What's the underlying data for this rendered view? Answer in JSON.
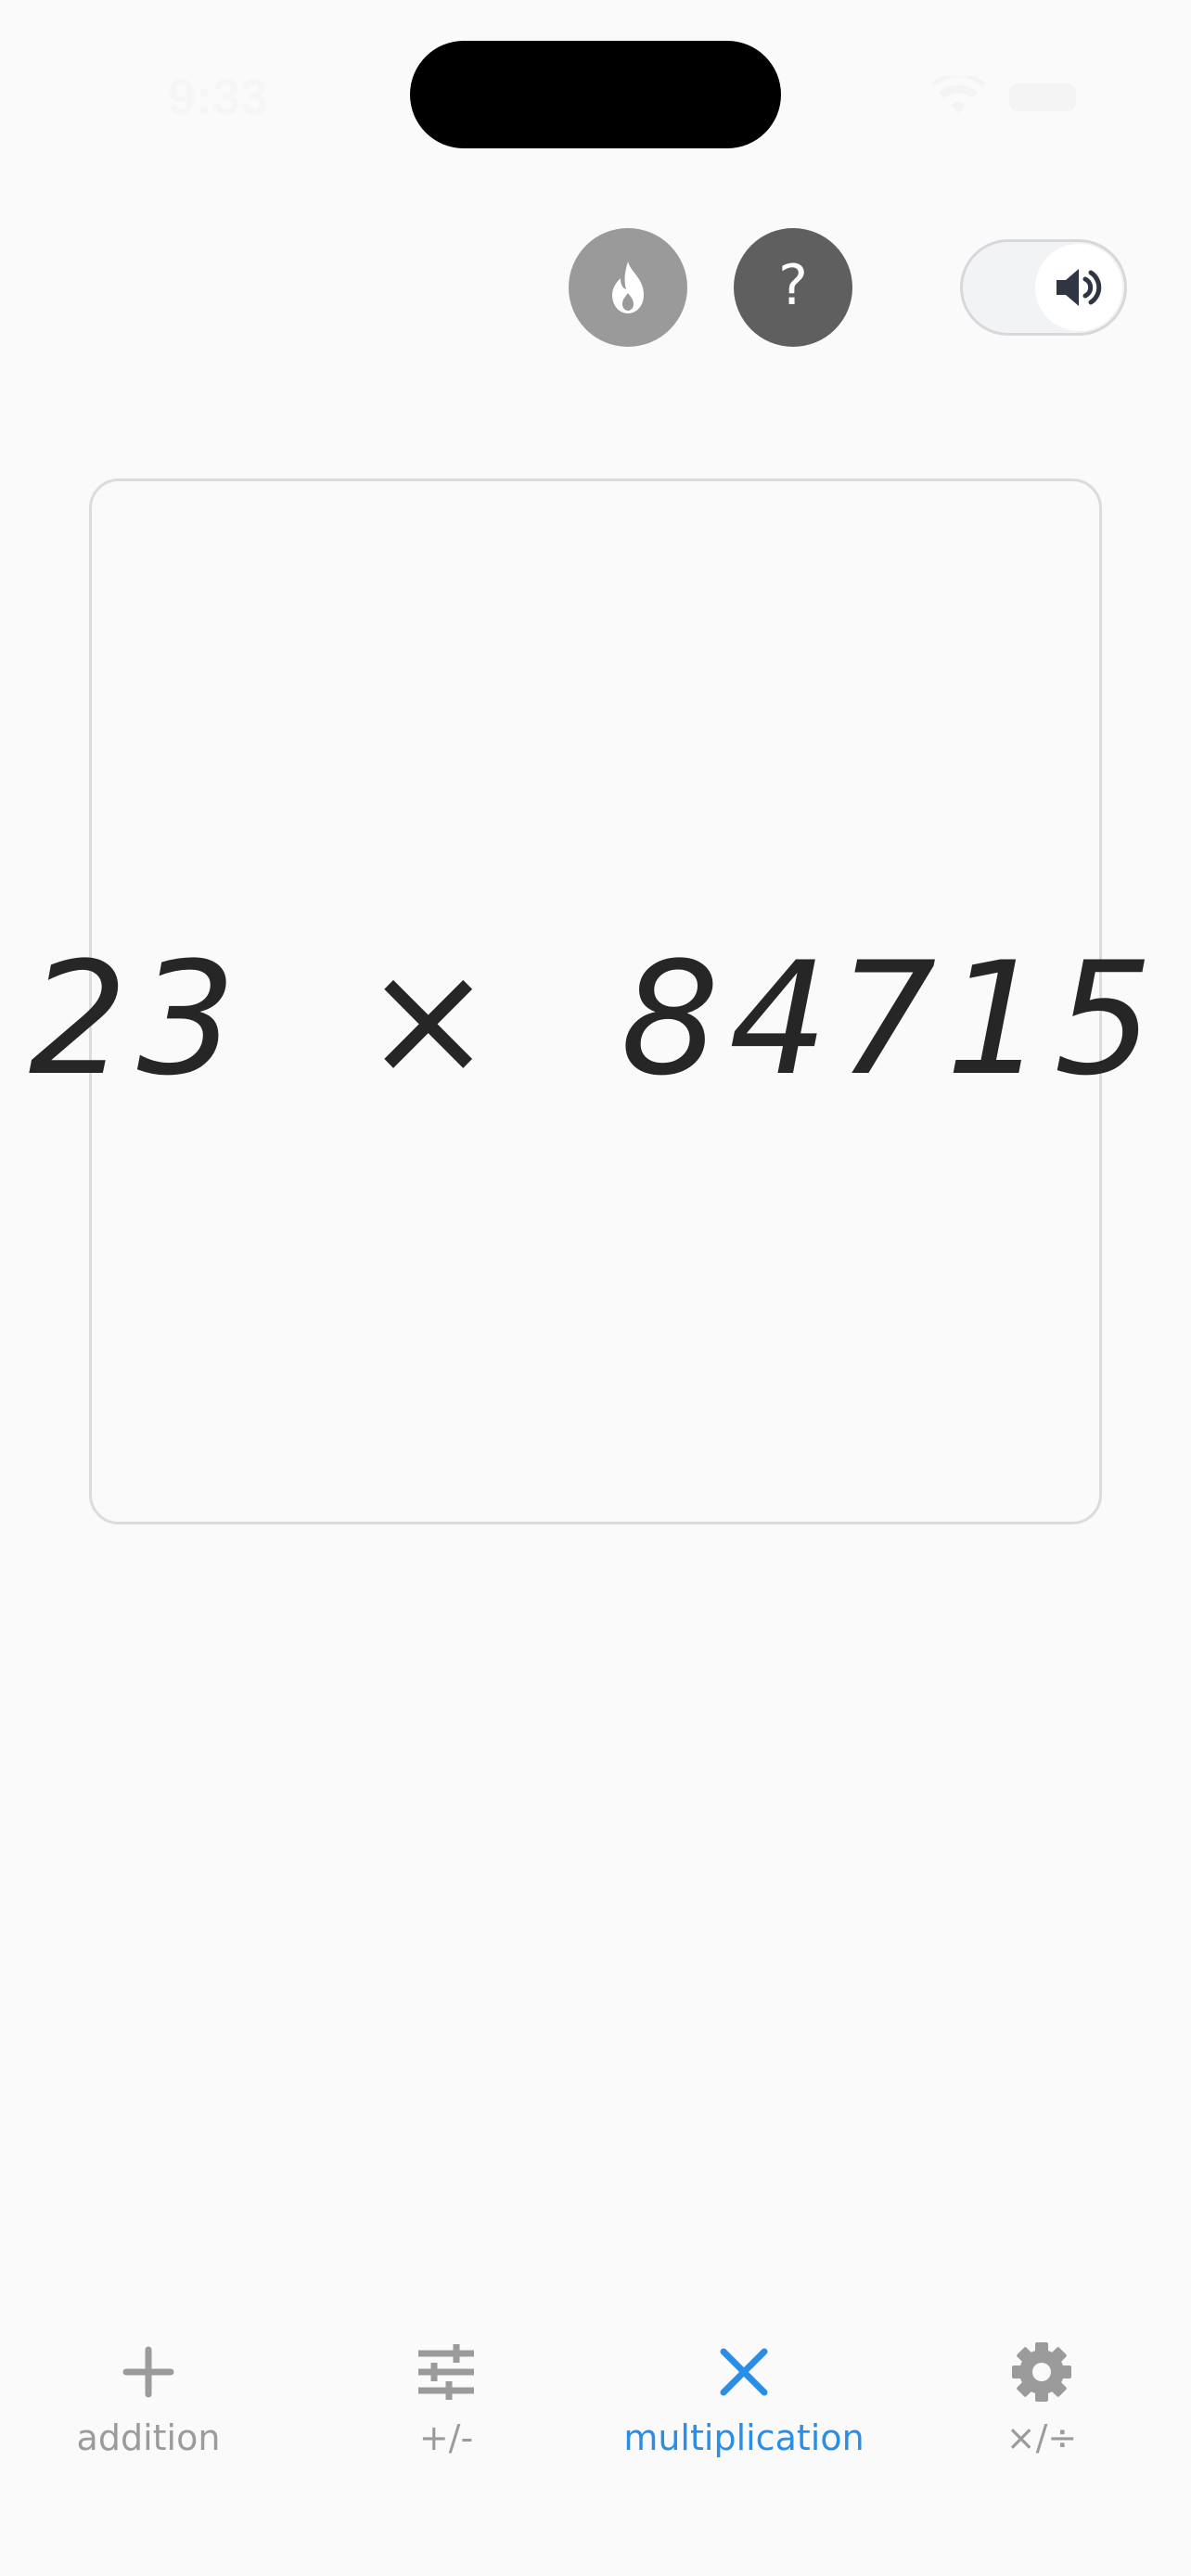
{
  "status_bar": {
    "time": "9:33"
  },
  "top_controls": {
    "streak_icon": "flame-icon",
    "help_label": "?",
    "sound_icon": "speaker-icon",
    "sound_on": true
  },
  "problem": {
    "text": "23  ×  84715"
  },
  "tabs": [
    {
      "label": "addition",
      "icon": "plus-icon",
      "active": false
    },
    {
      "label": "+/-",
      "icon": "sliders-icon",
      "active": false
    },
    {
      "label": "multiplication",
      "icon": "times-icon",
      "active": true
    },
    {
      "label": "×/÷",
      "icon": "gear-icon",
      "active": false
    }
  ],
  "colors": {
    "accent": "#2b8ee6",
    "inactive": "#9b9b9b",
    "background": "#fafafa"
  }
}
